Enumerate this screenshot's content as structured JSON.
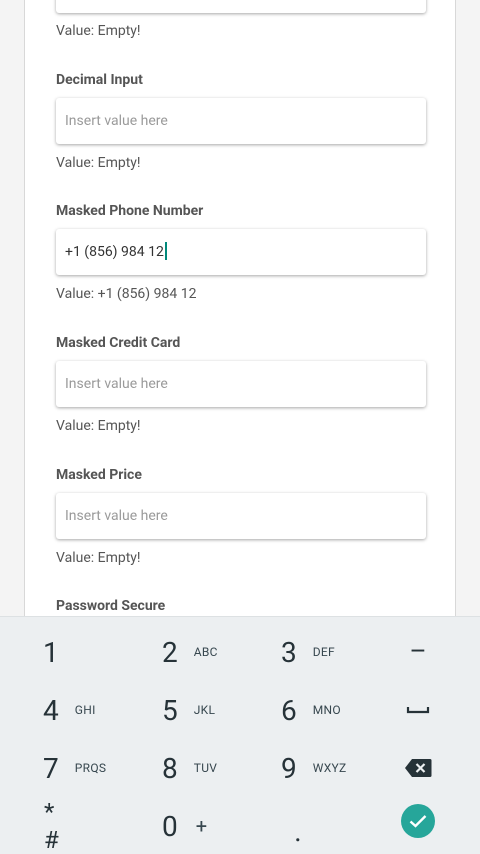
{
  "form": {
    "fields": [
      {
        "label": "",
        "value_text": "Value: Empty!"
      },
      {
        "label": "Decimal Input",
        "placeholder": "Insert value here",
        "value_text": "Value: Empty!"
      },
      {
        "label": "Masked Phone Number",
        "input_value": "+1 (856) 984 12",
        "value_text": "Value: +1 (856) 984 12"
      },
      {
        "label": "Masked Credit Card",
        "placeholder": "Insert value here",
        "value_text": "Value: Empty!"
      },
      {
        "label": "Masked Price",
        "placeholder": "Insert value here",
        "value_text": "Value: Empty!"
      },
      {
        "label": "Password Secure"
      }
    ]
  },
  "keyboard": {
    "keys": [
      {
        "digit": "1",
        "letters": ""
      },
      {
        "digit": "2",
        "letters": "ABC"
      },
      {
        "digit": "3",
        "letters": "DEF"
      },
      {
        "digit": "4",
        "letters": "GHI"
      },
      {
        "digit": "5",
        "letters": "JKL"
      },
      {
        "digit": "6",
        "letters": "MNO"
      },
      {
        "digit": "7",
        "letters": "PRQS"
      },
      {
        "digit": "8",
        "letters": "TUV"
      },
      {
        "digit": "9",
        "letters": "WXYZ"
      },
      {
        "digit": "0",
        "letters": "+"
      }
    ],
    "symbols": {
      "minus": "–",
      "star_hash": "* #",
      "period": "."
    },
    "icons": {
      "space": "space-icon",
      "backspace": "backspace-icon",
      "done": "check-icon"
    },
    "accent_color": "#26a69a"
  }
}
